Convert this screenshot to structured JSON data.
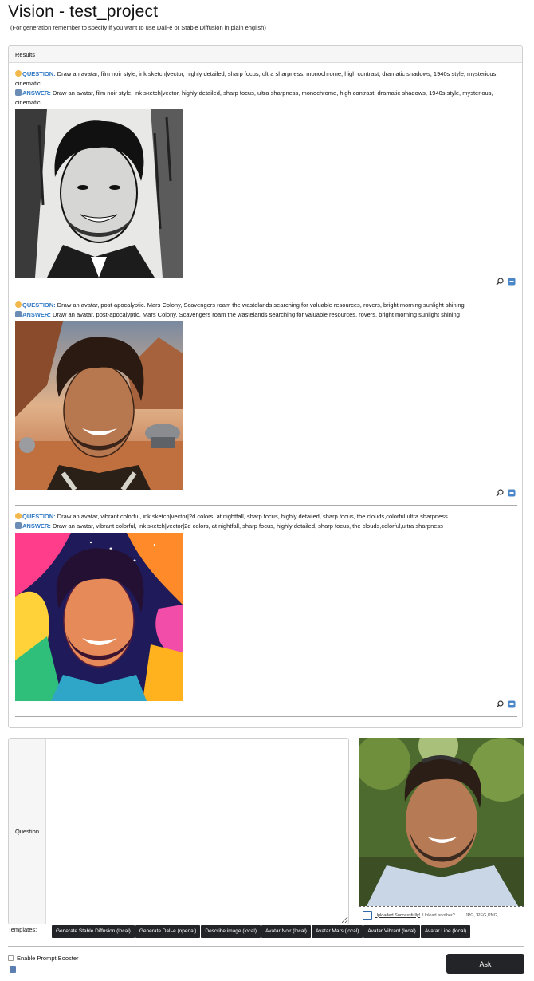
{
  "page": {
    "title": "Vision - test_project",
    "subtitle": "(For generation remember to specify if you want to use Dall-e or Stable Diffusion in plain english)"
  },
  "results": {
    "header": "Results",
    "entries": [
      {
        "question_label": "QUESTION:",
        "question": "Draw an avatar, film noir style, ink sketch|vector, highly detailed, sharp focus, ultra sharpness, monochrome, high contrast, dramatic shadows, 1940s style, mysterious, cinematic",
        "answer_label": "ANSWER:",
        "answer": "Draw an avatar, film noir style, ink sketch|vector, highly detailed, sharp focus, ultra sharpness, monochrome, high contrast, dramatic shadows, 1940s style, mysterious, cinematic"
      },
      {
        "question_label": "QUESTION:",
        "question": "Draw an avatar, post-apocalyptic. Mars Colony, Scavengers roam the wastelands searching for valuable resources, rovers, bright morning sunlight shining",
        "answer_label": "ANSWER:",
        "answer": "Draw an avatar, post-apocalyptic. Mars Colony, Scavengers roam the wastelands searching for valuable resources, rovers, bright morning sunlight shining"
      },
      {
        "question_label": "QUESTION:",
        "question": "Draw an avatar, vibrant colorful, ink sketch|vector|2d colors, at nightfall, sharp focus, highly detailed, sharp focus, the clouds,colorful,ultra sharpness",
        "answer_label": "ANSWER:",
        "answer": "Draw an avatar, vibrant colorful, ink sketch|vector|2d colors, at nightfall, sharp focus, highly detailed, sharp focus, the clouds,colorful,ultra sharpness"
      }
    ]
  },
  "question_form": {
    "label": "Question",
    "value": ""
  },
  "upload": {
    "success_text": "Uploaded Successfully!",
    "another_text": "Upload another?",
    "types_text": "JPG,JPEG,PNG,..."
  },
  "templates": {
    "label": "Templates:",
    "buttons": [
      "Generate Stable Diffusion (local)",
      "Generate Dall-e (openai)",
      "Describe image (local)",
      "Avatar Noir (local)",
      "Avatar Mars (local)",
      "Avatar Vibrant (local)",
      "Avatar Line (local)"
    ]
  },
  "options": {
    "prompt_booster_label": "Enable Prompt Booster",
    "prompt_booster_checked": false
  },
  "ask_button": "Ask",
  "colors": {
    "accent_blue": "#2f78c4",
    "dark_button": "#222427"
  }
}
